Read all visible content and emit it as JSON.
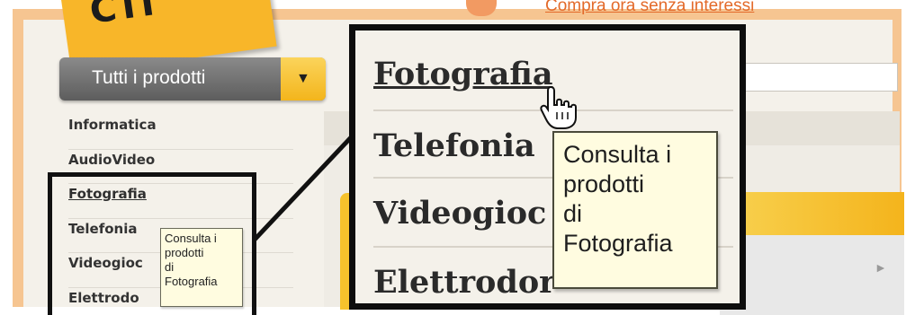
{
  "header": {
    "promo_text": "Compra ora senza interessi",
    "sticky_note_text": "CTI"
  },
  "category_dropdown": {
    "label": "Tutti i prodotti",
    "arrow": "▼"
  },
  "menu": {
    "items": [
      {
        "label": "Informatica"
      },
      {
        "label": "AudioVideo"
      },
      {
        "label": "Fotografia"
      },
      {
        "label": "Telefonia"
      },
      {
        "label": "Videogioc"
      },
      {
        "label": "Elettrodo"
      }
    ]
  },
  "zoom": {
    "items": [
      {
        "label": "Fotografia"
      },
      {
        "label": "Telefonia"
      },
      {
        "label": "Videogioc"
      },
      {
        "label": "Elettrodor"
      }
    ]
  },
  "tooltip": {
    "text": "Consulta i\nprodotti\ndi\nFotografia"
  },
  "colors": {
    "frame": "#f6c591",
    "accent_yellow": "#f4b41c",
    "tooltip_bg": "#fffce0",
    "promo": "#e36a2a"
  },
  "icons": {
    "cursor": "hand-pointer-icon",
    "dropdown": "chevron-down-icon"
  }
}
